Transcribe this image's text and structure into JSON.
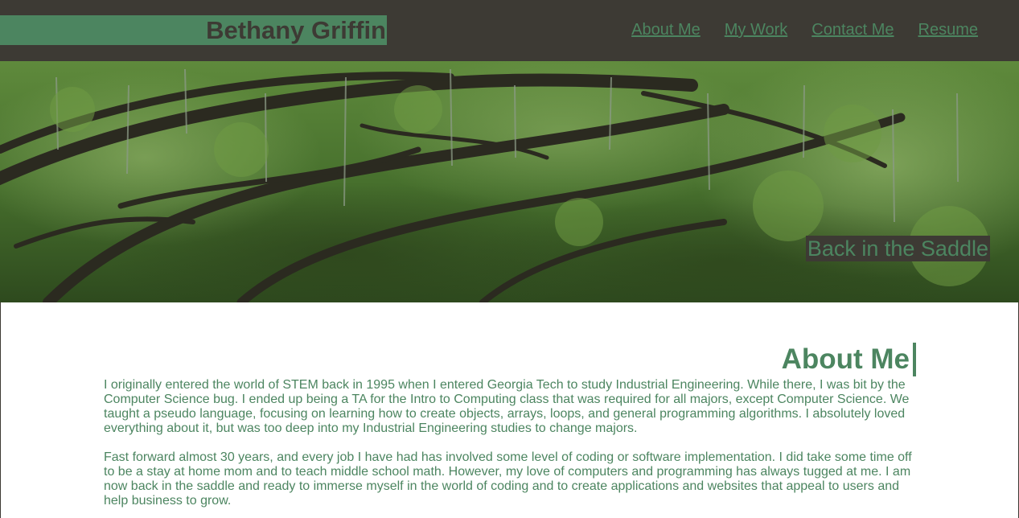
{
  "header": {
    "brand": "Bethany Griffin",
    "nav": [
      "About Me",
      "My Work",
      "Contact Me",
      "Resume"
    ]
  },
  "hero": {
    "caption": "Back in the Saddle",
    "image": "live oak trees with spanish moss"
  },
  "about": {
    "title": "About Me",
    "paragraphs": [
      "I originally entered the world of STEM back in 1995 when I entered Georgia Tech to study Industrial Engineering. While there, I was bit by the Computer Science bug. I ended up being a TA for the Intro to Computing class that was required for all majors, except Computer Science. We taught a pseudo language, focusing on learning how to create objects, arrays, loops, and general programming algorithms. I absolutely loved everything about it, but was too deep into my Industrial Engineering studies to change majors.",
      "Fast forward almost 30 years, and every job I have had has involved some level of coding or software implementation. I did take some time off to be a stay at home mom and to teach middle school math. However, my love of computers and programming has always tugged at me. I am now back in the saddle and ready to immerse myself in the world of coding and to create applications and websites that appeal to users and help business to grow."
    ]
  },
  "colors": {
    "header_bg": "#3d3a34",
    "accent_green": "#4c8560",
    "page_bg": "#ffffff"
  }
}
